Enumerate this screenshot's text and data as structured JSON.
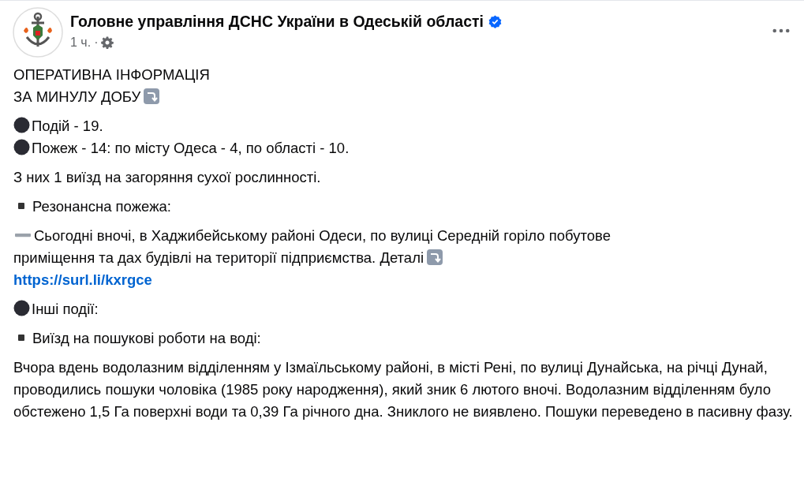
{
  "post": {
    "author": "Головне управління ДСНС України в Одеській області",
    "verified": true,
    "time": "1 ч.",
    "separator": "·"
  },
  "paragraphs": [
    {
      "lines": [
        {
          "kind": "plain",
          "text": "ОПЕРАТИВНА ІНФОРМАЦІЯ",
          "arrow": false
        },
        {
          "kind": "plain",
          "text": "ЗА МИНУЛУ ДОБУ",
          "arrow": true
        }
      ]
    },
    {
      "lines": [
        {
          "kind": "dot",
          "text": "Подій - 19.",
          "arrow": false
        },
        {
          "kind": "dot",
          "text": "Пожеж - 14: по місту Одеса - 4, по області - 10.",
          "arrow": false
        }
      ]
    },
    {
      "lines": [
        {
          "kind": "plain",
          "text": "З них 1 виїзд на загоряння сухої рослинності.",
          "arrow": false
        }
      ]
    },
    {
      "lines": [
        {
          "kind": "square",
          "text": "Резонансна пожежа:",
          "arrow": false
        }
      ]
    },
    {
      "lines": [
        {
          "kind": "dash",
          "text": "Сьогодні вночі, в Хаджибейському районі Одеси, по вулиці Середній горіло побутове",
          "arrow": false
        },
        {
          "kind": "plain",
          "text": "приміщення та дах будівлі на території підприємства. Деталі",
          "arrow": true
        },
        {
          "kind": "link",
          "text": "https://surl.li/kxrgce",
          "arrow": false
        }
      ]
    },
    {
      "lines": [
        {
          "kind": "dot",
          "text": "Інші події:",
          "arrow": false
        }
      ]
    },
    {
      "lines": [
        {
          "kind": "square",
          "text": "Виїзд на пошукові роботи на воді:",
          "arrow": false
        }
      ]
    },
    {
      "lines": [
        {
          "kind": "plain",
          "text": "Вчора вдень водолазним відділенням у Ізмаїльському районі, в місті Рені, по вулиці Дунайська, на річці Дунай, проводились пошуки чоловіка (1985 року народження), який зник 6 лютого вночі. Водолазним відділенням було обстежено 1,5 Га поверхні води та 0,39 Га річного дна. Зниклого не виявлено. Пошуки переведено в пасивну фазу.",
          "arrow": false
        }
      ]
    }
  ]
}
